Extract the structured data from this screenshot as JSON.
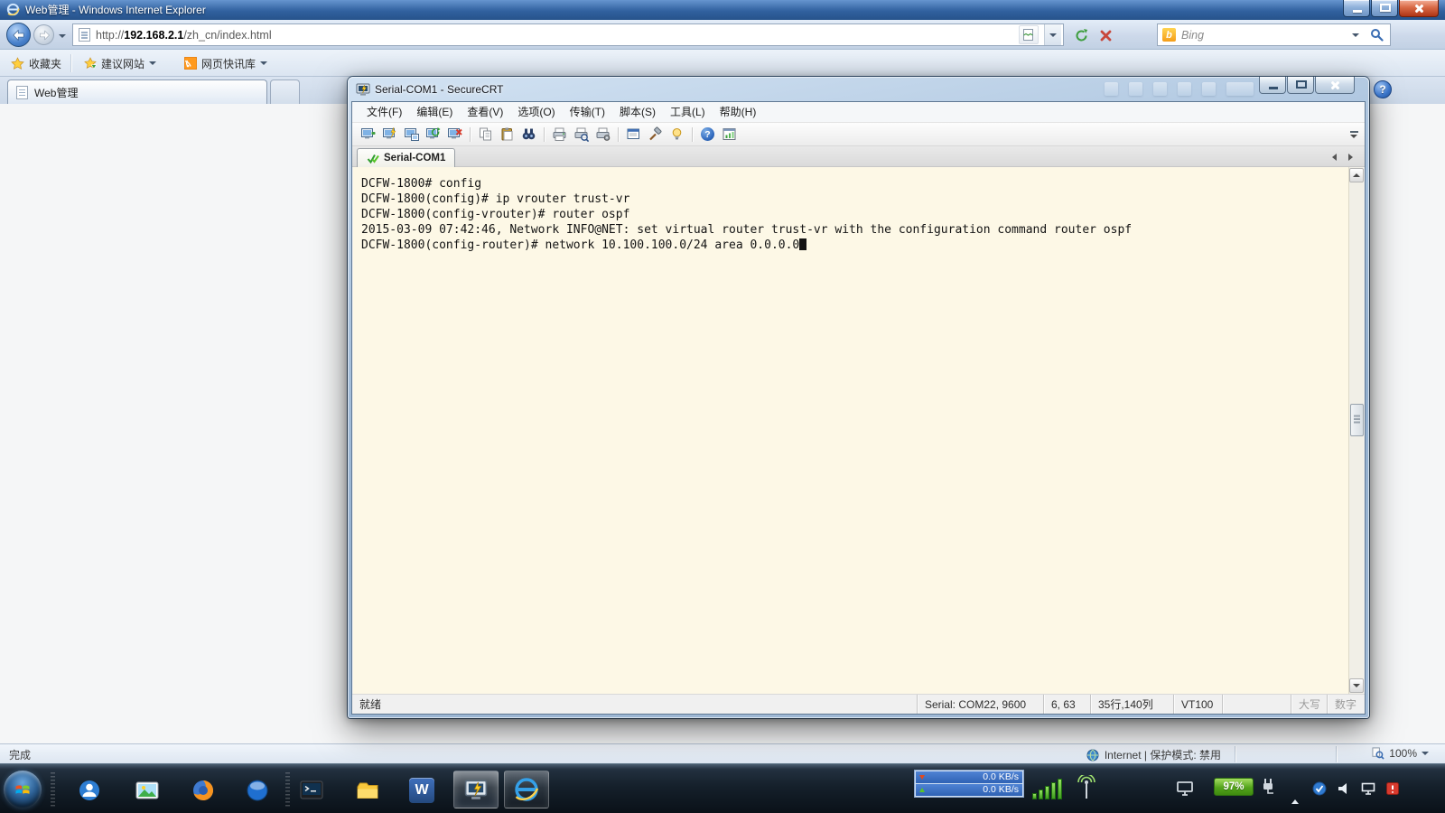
{
  "ie": {
    "title": "Web管理 - Windows Internet Explorer",
    "address": {
      "prefix": "http://",
      "domain": "192.168.2.1",
      "path": "/zh_cn/index.html"
    },
    "search": {
      "engine_label": "Bing",
      "logo_letter": "b"
    },
    "favorites_bar": {
      "favorites_label": "收藏夹",
      "suggested_sites_label": "建议网站",
      "web_slices_label": "网页快讯库"
    },
    "tab_label": "Web管理",
    "help_glyph": "?",
    "statusbar": {
      "status": "完成",
      "zone": "Internet | 保护模式: 禁用",
      "zoom": "100%"
    }
  },
  "securecrt": {
    "title": "Serial-COM1 - SecureCRT",
    "menu": [
      "文件(F)",
      "编辑(E)",
      "查看(V)",
      "选项(O)",
      "传输(T)",
      "脚本(S)",
      "工具(L)",
      "帮助(H)"
    ],
    "toolbar_icons": [
      "connect",
      "quick-connect",
      "connect-in-tab",
      "reconnect",
      "disconnect",
      "copy",
      "paste",
      "find",
      "print",
      "print-preview",
      "print-setup",
      "properties",
      "session-options",
      "keyword-highlighting",
      "help",
      "session-manager"
    ],
    "session_tab_label": "Serial-COM1",
    "help_glyph": "?",
    "terminal": {
      "lines": [
        "DCFW-1800# config",
        "DCFW-1800(config)# ip vrouter trust-vr",
        "DCFW-1800(config-vrouter)# router ospf",
        "2015-03-09 07:42:46, Network INFO@NET: set virtual router trust-vr with the configuration command router ospf",
        "DCFW-1800(config-router)# network 10.100.100.0/24 area 0.0.0.0"
      ]
    },
    "statusbar": {
      "ready": "就绪",
      "serial": "Serial: COM22, 9600",
      "cursor_pos": "6, 63",
      "screen_size": "35行,140列",
      "emulation": "VT100",
      "caps_label": "大写",
      "num_label": "数字"
    }
  },
  "taskbar": {
    "word_badge": "W",
    "tray": {
      "download_speed": "0.0 KB/s",
      "upload_speed": "0.0 KB/s",
      "battery_percent": "97%"
    }
  },
  "colors": {
    "ie_titlebar_blue": "#31619f",
    "terminal_background": "#fdf8e6",
    "battery_green": "#53a41b",
    "close_button_red": "#b03415"
  }
}
